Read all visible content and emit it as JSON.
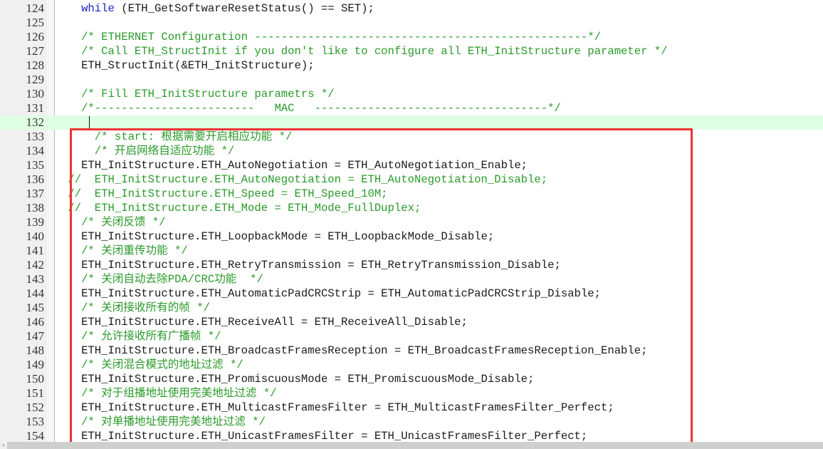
{
  "editor": {
    "colors": {
      "keyword": "#2020c0",
      "comment": "#2a9a2a",
      "text": "#1a1a1a",
      "current_line_bg": "#e0fee4",
      "annotation_box": "#ee3333"
    },
    "current_line": 132,
    "annotation": "red rectangle around lines 133-154",
    "lines": [
      {
        "num": "124",
        "parts": [
          {
            "t": "   ",
            "c": "tx"
          },
          {
            "t": "while",
            "c": "kw"
          },
          {
            "t": " (ETH_GetSoftwareResetStatus() == SET);",
            "c": "tx"
          }
        ]
      },
      {
        "num": "125",
        "parts": []
      },
      {
        "num": "126",
        "parts": [
          {
            "t": "   /* ETHERNET Configuration --------------------------------------------------*/",
            "c": "cm"
          }
        ]
      },
      {
        "num": "127",
        "parts": [
          {
            "t": "   /* Call ETH_StructInit if you don't like to configure all ETH_InitStructure parameter */",
            "c": "cm"
          }
        ]
      },
      {
        "num": "128",
        "parts": [
          {
            "t": "   ETH_StructInit(&ETH_InitStructure);",
            "c": "tx"
          }
        ]
      },
      {
        "num": "129",
        "parts": []
      },
      {
        "num": "130",
        "parts": [
          {
            "t": "   /* Fill ETH_InitStructure parametrs */",
            "c": "cm"
          }
        ]
      },
      {
        "num": "131",
        "parts": [
          {
            "t": "   /*------------------------   MAC   -----------------------------------*/",
            "c": "cm"
          }
        ]
      },
      {
        "num": "132",
        "parts": []
      },
      {
        "num": "133",
        "parts": [
          {
            "t": "     /* start: 根据需要开启相应功能 */",
            "c": "cm"
          }
        ]
      },
      {
        "num": "134",
        "parts": [
          {
            "t": "     /* 开启网络自适应功能 */",
            "c": "cm"
          }
        ]
      },
      {
        "num": "135",
        "parts": [
          {
            "t": "   ETH_InitStructure.ETH_AutoNegotiation = ETH_AutoNegotiation_Enable;",
            "c": "tx"
          }
        ]
      },
      {
        "num": "136",
        "parts": [
          {
            "t": " //  ETH_InitStructure.ETH_AutoNegotiation = ETH_AutoNegotiation_Disable;",
            "c": "cm"
          }
        ]
      },
      {
        "num": "137",
        "parts": [
          {
            "t": " //  ETH_InitStructure.ETH_Speed = ETH_Speed_10M;",
            "c": "cm"
          }
        ]
      },
      {
        "num": "138",
        "parts": [
          {
            "t": " //  ETH_InitStructure.ETH_Mode = ETH_Mode_FullDuplex;",
            "c": "cm"
          }
        ]
      },
      {
        "num": "139",
        "parts": [
          {
            "t": "   /* 关闭反馈 */",
            "c": "cm"
          }
        ]
      },
      {
        "num": "140",
        "parts": [
          {
            "t": "   ETH_InitStructure.ETH_LoopbackMode = ETH_LoopbackMode_Disable;",
            "c": "tx"
          }
        ]
      },
      {
        "num": "141",
        "parts": [
          {
            "t": "   /* 关闭重传功能 */",
            "c": "cm"
          }
        ]
      },
      {
        "num": "142",
        "parts": [
          {
            "t": "   ETH_InitStructure.ETH_RetryTransmission = ETH_RetryTransmission_Disable;",
            "c": "tx"
          }
        ]
      },
      {
        "num": "143",
        "parts": [
          {
            "t": "   /* 关闭自动去除PDA/CRC功能  */",
            "c": "cm"
          }
        ]
      },
      {
        "num": "144",
        "parts": [
          {
            "t": "   ETH_InitStructure.ETH_AutomaticPadCRCStrip = ETH_AutomaticPadCRCStrip_Disable;",
            "c": "tx"
          }
        ]
      },
      {
        "num": "145",
        "parts": [
          {
            "t": "   /* 关闭接收所有的帧 */",
            "c": "cm"
          }
        ]
      },
      {
        "num": "146",
        "parts": [
          {
            "t": "   ETH_InitStructure.ETH_ReceiveAll = ETH_ReceiveAll_Disable;",
            "c": "tx"
          }
        ]
      },
      {
        "num": "147",
        "parts": [
          {
            "t": "   /* 允许接收所有广播帧 */",
            "c": "cm"
          }
        ]
      },
      {
        "num": "148",
        "parts": [
          {
            "t": "   ETH_InitStructure.ETH_BroadcastFramesReception = ETH_BroadcastFramesReception_Enable;",
            "c": "tx"
          }
        ]
      },
      {
        "num": "149",
        "parts": [
          {
            "t": "   /* 关闭混合模式的地址过滤 */",
            "c": "cm"
          }
        ]
      },
      {
        "num": "150",
        "parts": [
          {
            "t": "   ETH_InitStructure.ETH_PromiscuousMode = ETH_PromiscuousMode_Disable;",
            "c": "tx"
          }
        ]
      },
      {
        "num": "151",
        "parts": [
          {
            "t": "   /* 对于组播地址使用完美地址过滤 */",
            "c": "cm"
          }
        ]
      },
      {
        "num": "152",
        "parts": [
          {
            "t": "   ETH_InitStructure.ETH_MulticastFramesFilter = ETH_MulticastFramesFilter_Perfect;",
            "c": "tx"
          }
        ]
      },
      {
        "num": "153",
        "parts": [
          {
            "t": "   /* 对单播地址使用完美地址过滤 */",
            "c": "cm"
          }
        ]
      },
      {
        "num": "154",
        "parts": [
          {
            "t": "   ETH_InitStructure.ETH_UnicastFramesFilter = ETH_UnicastFramesFilter_Perfect;",
            "c": "tx"
          }
        ]
      }
    ]
  },
  "scrollbar": {
    "left_arrow_icon": "‹"
  }
}
